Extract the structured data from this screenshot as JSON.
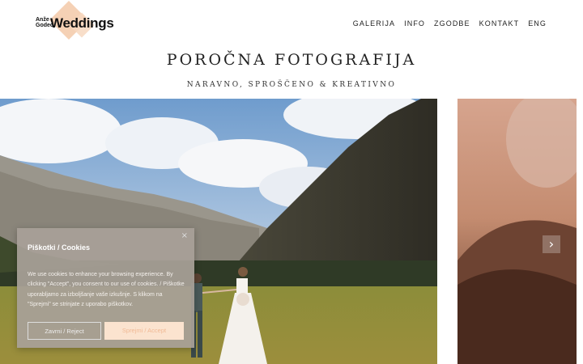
{
  "logo": {
    "small_line1": "Anže",
    "small_line2": "Godec",
    "big_text": "Weddings"
  },
  "nav": {
    "items": [
      "GALERIJA",
      "INFO",
      "ZGODBE",
      "KONTAKT",
      "ENG"
    ]
  },
  "hero": {
    "title": "POROČNA FOTOGRAFIJA",
    "subtitle": "NARAVNO, SPROŠČENO & KREATIVNO"
  },
  "gallery": {
    "next_arrow_icon": "chevron-right-icon"
  },
  "cookie": {
    "title": "Piškotki / Cookies",
    "close_icon": "close-icon",
    "text": "We use cookies to enhance your browsing experience. By clicking \"Accept\", you consent to our use of cookies. / Piškotke uporabljamo za izboljšanje vaše izkušnje. S klikom na \"Sprejmi\" se strinjate z uporabo piškotkov.",
    "reject_label": "Zavrni / Reject",
    "accept_label": "Sprejmi / Accept"
  },
  "colors": {
    "accent": "#f3c9a8",
    "cookie_bg": "#a8a098",
    "accept_bg": "#fbe3cf"
  }
}
